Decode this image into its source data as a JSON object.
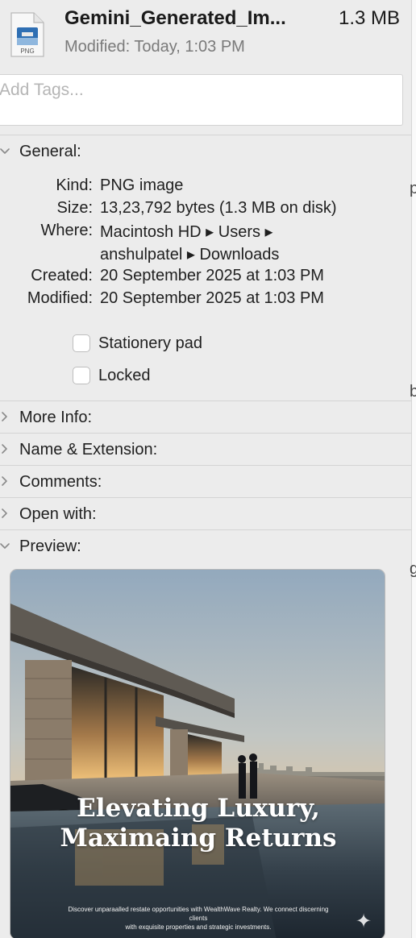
{
  "header": {
    "file_name": "Gemini_Generated_Im...",
    "file_size": "1.3 MB",
    "modified_label": "Modified:",
    "modified_value": "Today, 1:03 PM",
    "icon_type_label": "PNG"
  },
  "tags": {
    "placeholder": "Add Tags..."
  },
  "general": {
    "label": "General:",
    "rows": [
      {
        "key": "Kind:",
        "value": "PNG image"
      },
      {
        "key": "Size:",
        "value": "13,23,792 bytes (1.3 MB on disk)"
      },
      {
        "key": "Where:",
        "value": "Macintosh HD ▸ Users ▸"
      },
      {
        "key": "",
        "value": "anshulpatel ▸ Downloads"
      },
      {
        "key": "Created:",
        "value": "20 September 2025 at 1:03 PM"
      },
      {
        "key": "Modified:",
        "value": "20 September 2025 at 1:03 PM"
      }
    ],
    "stationery_label": "Stationery pad",
    "stationery_checked": false,
    "locked_label": "Locked",
    "locked_checked": false
  },
  "sections": {
    "more_info": "More Info:",
    "name_extension": "Name & Extension:",
    "comments": "Comments:",
    "open_with": "Open with:",
    "preview": "Preview:"
  },
  "preview": {
    "headline_line1": "Elevating Luxury,",
    "headline_line2": "Maximaing Returns",
    "subtext_line1": "Discover unparaalled restate opportunities with WealthWave Realty. We connect discerning clients",
    "subtext_line2": "with exquisite properties and strategic investments.",
    "star_icon": "sparkle-icon"
  },
  "colors": {
    "window_bg": "#ececec",
    "label_text": "#1f1f1f",
    "secondary_text": "#7a7a7a"
  }
}
